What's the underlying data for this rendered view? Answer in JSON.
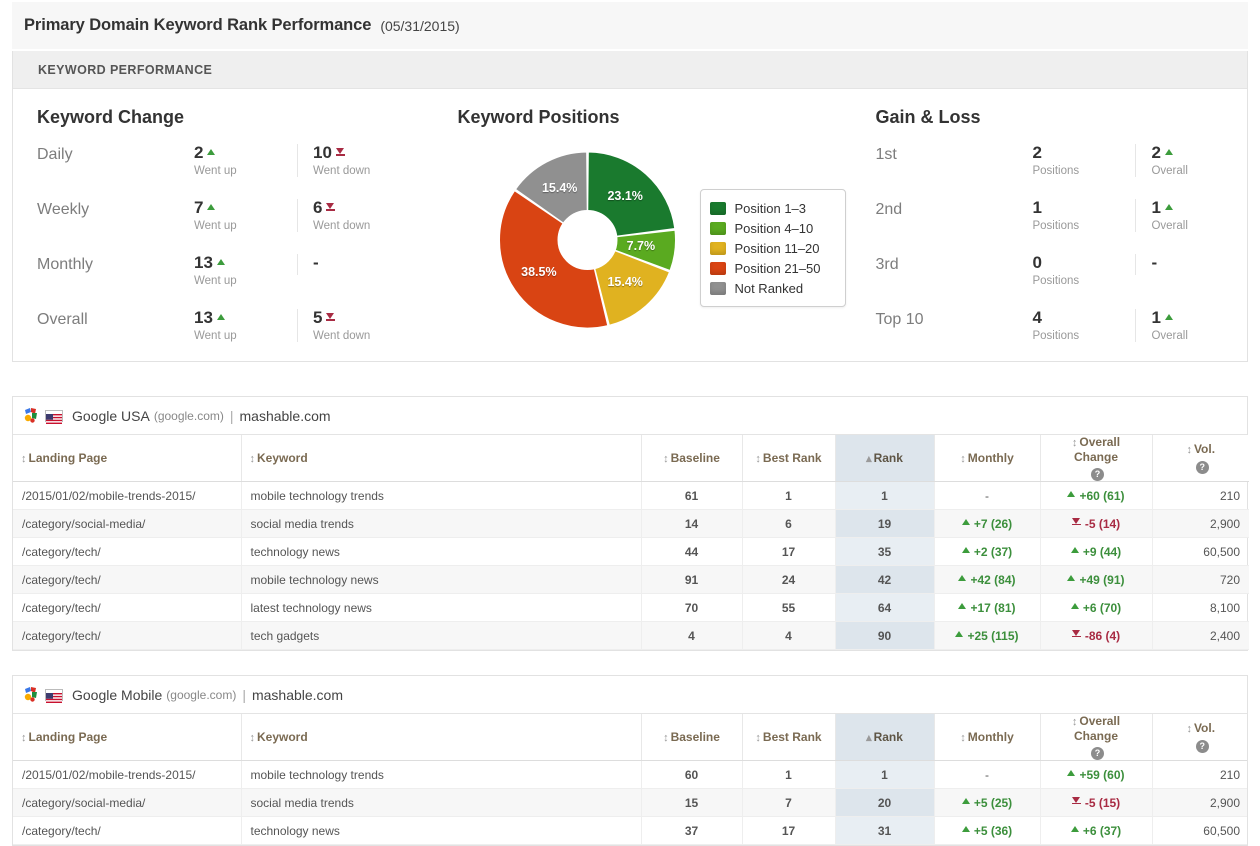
{
  "header": {
    "title": "Primary Domain Keyword Rank Performance",
    "date": "(05/31/2015)",
    "panel_label": "KEYWORD PERFORMANCE"
  },
  "keyword_change": {
    "title": "Keyword Change",
    "rows": [
      {
        "label": "Daily",
        "up_value": "2",
        "up_sub": "Went up",
        "down_value": "10",
        "down_sub": "Went down",
        "down_is_dash": false
      },
      {
        "label": "Weekly",
        "up_value": "7",
        "up_sub": "Went up",
        "down_value": "6",
        "down_sub": "Went down",
        "down_is_dash": false
      },
      {
        "label": "Monthly",
        "up_value": "13",
        "up_sub": "Went up",
        "down_value": "-",
        "down_sub": "",
        "down_is_dash": true
      },
      {
        "label": "Overall",
        "up_value": "13",
        "up_sub": "Went up",
        "down_value": "5",
        "down_sub": "Went down",
        "down_is_dash": false
      }
    ]
  },
  "keyword_positions": {
    "title": "Keyword Positions"
  },
  "chart_data": {
    "type": "pie",
    "title": "Keyword Positions",
    "donut": true,
    "legend_position": "right",
    "categories": [
      "Position 1–3",
      "Position 4–10",
      "Position 11–20",
      "Position 21–50",
      "Not Ranked"
    ],
    "values": [
      23.1,
      7.7,
      15.4,
      38.5,
      15.4
    ],
    "labels": [
      "23.1%",
      "7.7%",
      "15.4%",
      "38.5%",
      "15.4%"
    ],
    "colors": [
      "#1a7a2e",
      "#5aaa20",
      "#e0b220",
      "#d94413",
      "#909090"
    ],
    "unit": "%"
  },
  "gain_loss": {
    "title": "Gain & Loss",
    "rows": [
      {
        "label": "1st",
        "pos_value": "2",
        "pos_sub": "Positions",
        "ovr_value": "2",
        "ovr_sub": "Overall",
        "ovr_is_dash": false
      },
      {
        "label": "2nd",
        "pos_value": "1",
        "pos_sub": "Positions",
        "ovr_value": "1",
        "ovr_sub": "Overall",
        "ovr_is_dash": false
      },
      {
        "label": "3rd",
        "pos_value": "0",
        "pos_sub": "Positions",
        "ovr_value": "-",
        "ovr_sub": "",
        "ovr_is_dash": true
      },
      {
        "label": "Top 10",
        "pos_value": "4",
        "pos_sub": "Positions",
        "ovr_value": "1",
        "ovr_sub": "Overall",
        "ovr_is_dash": false
      }
    ]
  },
  "tables": [
    {
      "id": "tbl-usa",
      "engine": "Google USA",
      "engine_domain": "(google.com)",
      "separator": "|",
      "site": "mashable.com",
      "columns": [
        {
          "label": "Landing Page",
          "sort": "both",
          "sorted": false,
          "align": "left",
          "help": false
        },
        {
          "label": "Keyword",
          "sort": "both",
          "sorted": false,
          "align": "left",
          "help": false
        },
        {
          "label": "Baseline",
          "sort": "both",
          "sorted": false,
          "align": "center",
          "help": false
        },
        {
          "label": "Best Rank",
          "sort": "both",
          "sorted": false,
          "align": "center",
          "help": false
        },
        {
          "label": "Rank",
          "sort": "asc",
          "sorted": true,
          "align": "center",
          "help": false
        },
        {
          "label": "Monthly",
          "sort": "both",
          "sorted": false,
          "align": "center",
          "help": false
        },
        {
          "label": "Overall Change",
          "sort": "both",
          "sorted": false,
          "align": "center",
          "help": true
        },
        {
          "label": "Vol.",
          "sort": "both",
          "sorted": false,
          "align": "right",
          "help": true
        }
      ],
      "rows": [
        {
          "landing_page": "/2015/01/02/mobile-trends-2015/",
          "keyword": "mobile technology trends",
          "baseline": "61",
          "best_rank": "1",
          "rank": "1",
          "monthly": "-",
          "monthly_dir": "none",
          "overall": "+60 (61)",
          "overall_dir": "up",
          "volume": "210"
        },
        {
          "landing_page": "/category/social-media/",
          "keyword": "social media trends",
          "baseline": "14",
          "best_rank": "6",
          "rank": "19",
          "monthly": "+7 (26)",
          "monthly_dir": "up",
          "overall": "-5 (14)",
          "overall_dir": "down",
          "volume": "2,900"
        },
        {
          "landing_page": "/category/tech/",
          "keyword": "technology news",
          "baseline": "44",
          "best_rank": "17",
          "rank": "35",
          "monthly": "+2 (37)",
          "monthly_dir": "up",
          "overall": "+9 (44)",
          "overall_dir": "up",
          "volume": "60,500"
        },
        {
          "landing_page": "/category/tech/",
          "keyword": "mobile technology news",
          "baseline": "91",
          "best_rank": "24",
          "rank": "42",
          "monthly": "+42 (84)",
          "monthly_dir": "up",
          "overall": "+49 (91)",
          "overall_dir": "up",
          "volume": "720"
        },
        {
          "landing_page": "/category/tech/",
          "keyword": "latest technology news",
          "baseline": "70",
          "best_rank": "55",
          "rank": "64",
          "monthly": "+17 (81)",
          "monthly_dir": "up",
          "overall": "+6 (70)",
          "overall_dir": "up",
          "volume": "8,100"
        },
        {
          "landing_page": "/category/tech/",
          "keyword": "tech gadgets",
          "baseline": "4",
          "best_rank": "4",
          "rank": "90",
          "monthly": "+25 (115)",
          "monthly_dir": "up",
          "overall": "-86 (4)",
          "overall_dir": "down",
          "volume": "2,400"
        }
      ]
    },
    {
      "id": "tbl-mobile",
      "engine": "Google Mobile",
      "engine_domain": "(google.com)",
      "separator": "|",
      "site": "mashable.com",
      "columns": [
        {
          "label": "Landing Page",
          "sort": "both",
          "sorted": false,
          "align": "left",
          "help": false
        },
        {
          "label": "Keyword",
          "sort": "both",
          "sorted": false,
          "align": "left",
          "help": false
        },
        {
          "label": "Baseline",
          "sort": "both",
          "sorted": false,
          "align": "center",
          "help": false
        },
        {
          "label": "Best Rank",
          "sort": "both",
          "sorted": false,
          "align": "center",
          "help": false
        },
        {
          "label": "Rank",
          "sort": "asc",
          "sorted": true,
          "align": "center",
          "help": false
        },
        {
          "label": "Monthly",
          "sort": "both",
          "sorted": false,
          "align": "center",
          "help": false
        },
        {
          "label": "Overall Change",
          "sort": "both",
          "sorted": false,
          "align": "center",
          "help": true
        },
        {
          "label": "Vol.",
          "sort": "both",
          "sorted": false,
          "align": "right",
          "help": true
        }
      ],
      "rows": [
        {
          "landing_page": "/2015/01/02/mobile-trends-2015/",
          "keyword": "mobile technology trends",
          "baseline": "60",
          "best_rank": "1",
          "rank": "1",
          "monthly": "-",
          "monthly_dir": "none",
          "overall": "+59 (60)",
          "overall_dir": "up",
          "volume": "210"
        },
        {
          "landing_page": "/category/social-media/",
          "keyword": "social media trends",
          "baseline": "15",
          "best_rank": "7",
          "rank": "20",
          "monthly": "+5 (25)",
          "monthly_dir": "up",
          "overall": "-5 (15)",
          "overall_dir": "down",
          "volume": "2,900"
        },
        {
          "landing_page": "/category/tech/",
          "keyword": "technology news",
          "baseline": "37",
          "best_rank": "17",
          "rank": "31",
          "monthly": "+5 (36)",
          "monthly_dir": "up",
          "overall": "+6 (37)",
          "overall_dir": "up",
          "volume": "60,500"
        }
      ]
    }
  ],
  "colors": {
    "up": "#3c8f3c",
    "down": "#a82b43",
    "sorted_header_bg": "#dde5ec",
    "panel_header_bg": "#efefef",
    "title_bg": "#f7f7f7"
  },
  "column_widths": [
    "228px",
    "400px",
    "101px",
    "93px",
    "99px",
    "106px",
    "112px",
    "97px"
  ]
}
